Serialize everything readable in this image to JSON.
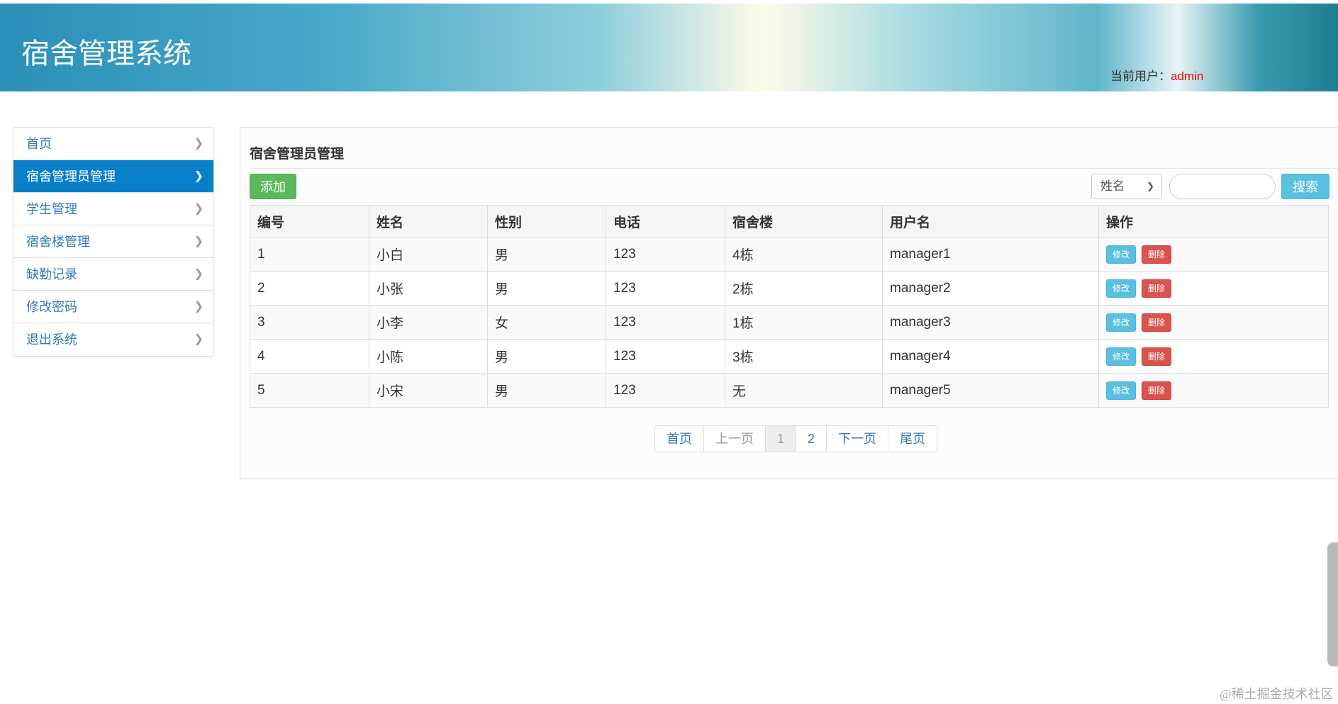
{
  "header": {
    "title": "宿舍管理系统",
    "user_label": "当前用户：",
    "user_name": "admin"
  },
  "sidebar": {
    "items": [
      {
        "label": "首页"
      },
      {
        "label": "宿舍管理员管理",
        "active": true
      },
      {
        "label": "学生管理"
      },
      {
        "label": "宿舍楼管理"
      },
      {
        "label": "缺勤记录"
      },
      {
        "label": "修改密码"
      },
      {
        "label": "退出系统"
      }
    ]
  },
  "panel": {
    "title": "宿舍管理员管理",
    "add_label": "添加",
    "search_field": "姓名",
    "search_value": "",
    "search_label": "搜索"
  },
  "table": {
    "headers": [
      "编号",
      "姓名",
      "性别",
      "电话",
      "宿舍楼",
      "用户名",
      "操作"
    ],
    "rows": [
      [
        "1",
        "小白",
        "男",
        "123",
        "4栋",
        "manager1"
      ],
      [
        "2",
        "小张",
        "男",
        "123",
        "2栋",
        "manager2"
      ],
      [
        "3",
        "小李",
        "女",
        "123",
        "1栋",
        "manager3"
      ],
      [
        "4",
        "小陈",
        "男",
        "123",
        "3栋",
        "manager4"
      ],
      [
        "5",
        "小宋",
        "男",
        "123",
        "无",
        "manager5"
      ]
    ],
    "edit_label": "修改",
    "delete_label": "删除"
  },
  "pagination": {
    "first": "首页",
    "prev": "上一页",
    "pages": [
      "1",
      "2"
    ],
    "current": "1",
    "next": "下一页",
    "last": "尾页"
  },
  "watermark": "@稀土掘金技术社区"
}
